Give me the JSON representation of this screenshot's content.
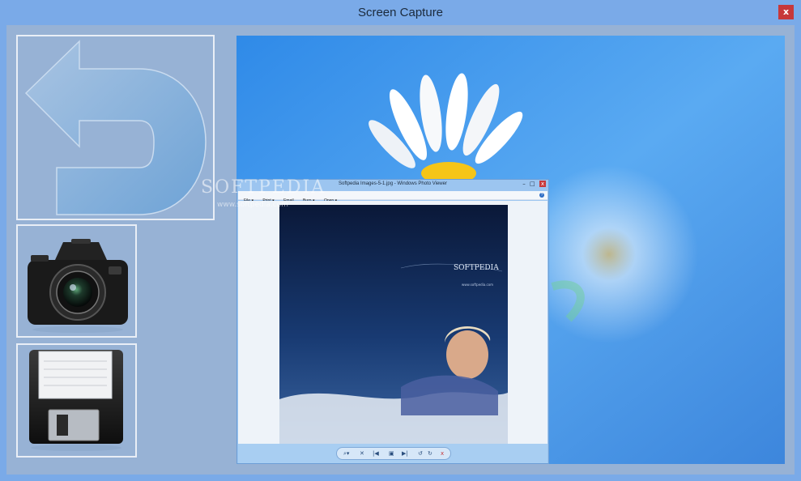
{
  "window": {
    "title": "Screen Capture",
    "close_glyph": "x"
  },
  "tiles": {
    "back_icon": "undo-arrow-icon",
    "capture_icon": "camera-icon",
    "save_icon": "floppy-disk-icon"
  },
  "preview": {
    "watermark": "SOFTPEDIA",
    "watermark_url": "www.softpedia.com",
    "viewer": {
      "title": "Softpedia Images-5-1.jpg - Windows Photo Viewer",
      "minimize_glyph": "–",
      "maximize_glyph": "□",
      "close_glyph": "x",
      "menu": [
        "File ▾",
        "Print ▾",
        "Email",
        "Burn ▾",
        "Open ▾"
      ],
      "help_glyph": "?",
      "photo_brand": "SOFTPEDIA",
      "photo_url": "www.softpedia.com",
      "toolbar": {
        "zoom": "⌕▾",
        "fit": "✕",
        "prev": "|◀",
        "slideshow": "▣",
        "next": "▶|",
        "rotate_ccw": "↺",
        "rotate_cw": "↻",
        "delete": "x"
      }
    }
  },
  "colors": {
    "frame": "#7aaae8",
    "client": "#97b2d5",
    "tile_border": "#e9eef6",
    "close": "#c7383a",
    "desktop_blue": "#4a9cec"
  }
}
